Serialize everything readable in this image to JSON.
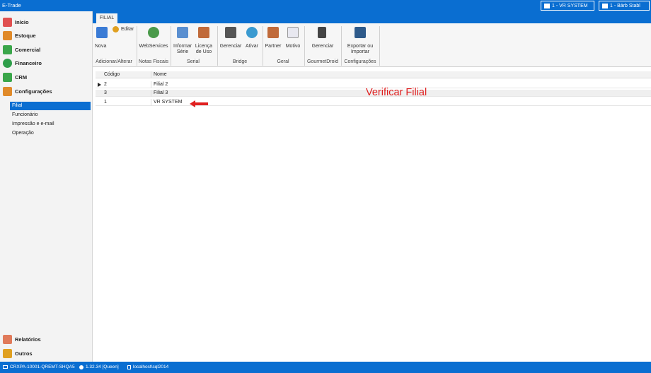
{
  "app": {
    "title": "E-Trade"
  },
  "titlebar": {
    "company_label": "1 - VR SYSTEM",
    "user_label": "1 - Bárb Stabl"
  },
  "ribbon": {
    "tab": "FILIAL",
    "buttons": {
      "nova": "Nova",
      "editar": "Editar",
      "webservices": "WebServices",
      "informar_serie_l1": "Informar",
      "informar_serie_l2": "Série",
      "licenca_l1": "Licença",
      "licenca_l2": "de Uso",
      "gerenciar_bridge": "Gerenciar",
      "ativar": "Ativar",
      "partner": "Partner",
      "motivo": "Motivo",
      "gerenciar_gourmet": "Gerenciar",
      "exportar_l1": "Exportar ou",
      "exportar_l2": "Importar"
    },
    "groups": {
      "adicionar": "Adicionar/Alterar",
      "notas": "Notas Fiscais",
      "serial": "Serial",
      "bridge": "Bridge",
      "geral": "Geral",
      "gourmet": "GourmetDroid",
      "configuracoes": "Configurações"
    }
  },
  "sidebar": {
    "items": [
      {
        "label": "Início",
        "icon": "home-icon",
        "color": "#e05050"
      },
      {
        "label": "Estoque",
        "icon": "boxes-icon",
        "color": "#e08a2a"
      },
      {
        "label": "Comercial",
        "icon": "commerce-icon",
        "color": "#3aa64a"
      },
      {
        "label": "Financeiro",
        "icon": "money-icon",
        "color": "#2e9e4a"
      },
      {
        "label": "CRM",
        "icon": "people-icon",
        "color": "#3aa64a"
      },
      {
        "label": "Configurações",
        "icon": "settings-icon",
        "color": "#e08a2a"
      }
    ],
    "subitems": [
      "Filial",
      "Funcionário",
      "Impressão e e-mail",
      "Operação"
    ],
    "bottom": [
      {
        "label": "Relatórios",
        "icon": "reports-icon"
      },
      {
        "label": "Outros",
        "icon": "others-icon"
      }
    ]
  },
  "table": {
    "columns": [
      "Código",
      "Nome"
    ],
    "rows": [
      {
        "codigo": "2",
        "nome": "Filial 2"
      },
      {
        "codigo": "3",
        "nome": "Filial 3"
      },
      {
        "codigo": "1",
        "nome": "VR SYSTEM"
      }
    ]
  },
  "annotation": {
    "text": "Verificar Filial",
    "color": "#e02020"
  },
  "statusbar": {
    "machine": "CRXPA-10001-QREMT-SHQA5",
    "version": "1.32.34 [Queen]",
    "database": "localhost\\sql2014"
  }
}
